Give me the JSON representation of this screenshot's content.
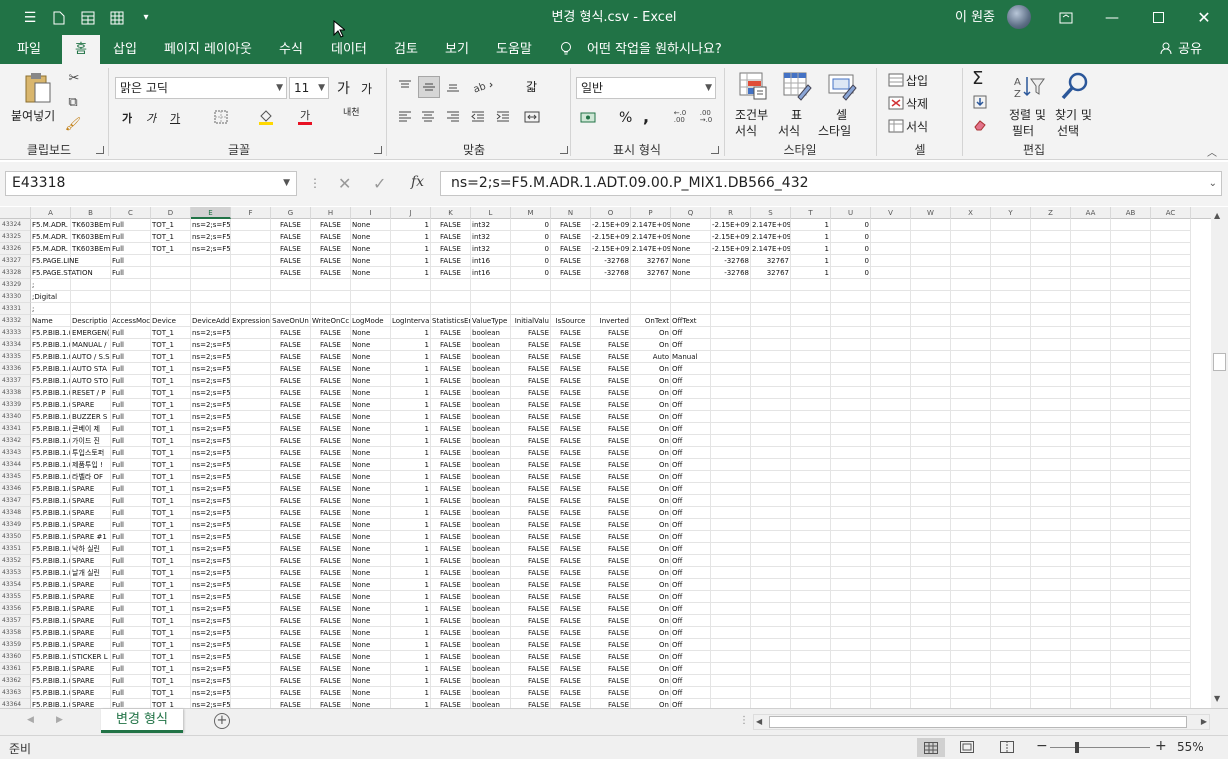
{
  "titlebar": {
    "title": "변경 형식.csv  -  Excel",
    "user": "이 원종",
    "qa_icons": [
      "menu-icon",
      "new-file-icon",
      "table-icon",
      "grid-icon",
      "customize-icon"
    ]
  },
  "tabs": [
    "파일",
    "홈",
    "삽입",
    "페이지 레이아웃",
    "수식",
    "데이터",
    "검토",
    "보기",
    "도움말"
  ],
  "tell_me": "어떤 작업을 원하시나요?",
  "share": "공유",
  "ribbon": {
    "clipboard": {
      "label": "클립보드",
      "paste": "붙여넣기"
    },
    "font": {
      "label": "글꼴",
      "name": "맑은 고딕",
      "size": "11",
      "bold": "가",
      "italic": "가",
      "underline": "가",
      "grow": "가",
      "shrink": "가",
      "phonetic": "내천"
    },
    "alignment": {
      "label": "맞춤",
      "wrap": "갋"
    },
    "number": {
      "label": "표시 형식",
      "format": "일반"
    },
    "styles": {
      "label": "스타일",
      "conditional": [
        "조건부",
        "서식"
      ],
      "table": [
        "표",
        "서식"
      ],
      "cell": [
        "셀",
        "스타일"
      ]
    },
    "cells": {
      "label": "셀",
      "insert": "삽입",
      "delete": "삭제",
      "format": "서식"
    },
    "editing": {
      "label": "편집",
      "sort": [
        "정렬 및",
        "필터"
      ],
      "find": [
        "찾기 및",
        "선택"
      ]
    }
  },
  "namebox": "E43318",
  "formula": "ns=2;s=F5.M.ADR.1.ADT.09.00.P_MIX1.DB566_432",
  "columns": [
    "A",
    "B",
    "C",
    "D",
    "E",
    "F",
    "G",
    "H",
    "I",
    "J",
    "K",
    "L",
    "M",
    "N",
    "O",
    "P",
    "Q",
    "R",
    "S",
    "T",
    "U",
    "V",
    "W",
    "X",
    "Y",
    "Z",
    "AA",
    "AB",
    "AC"
  ],
  "selected_column": "E",
  "rows": [
    {
      "n": "43324",
      "cells": [
        "F5.M.ADR.",
        "TK603BEm",
        "Full",
        "TOT_1",
        "ns=2;s=F5.M.ADR.1.A",
        "",
        "FALSE",
        "FALSE",
        "None",
        "1",
        "FALSE",
        "int32",
        "0",
        "FALSE",
        "-2.15E+09",
        "2.147E+09",
        "None",
        "-2.15E+09",
        "2.147E+09",
        "1",
        "0"
      ]
    },
    {
      "n": "43325",
      "cells": [
        "F5.M.ADR.",
        "TK603BEm",
        "Full",
        "TOT_1",
        "ns=2;s=F5.M.ADR.1.A",
        "",
        "FALSE",
        "FALSE",
        "None",
        "1",
        "FALSE",
        "int32",
        "0",
        "FALSE",
        "-2.15E+09",
        "2.147E+09",
        "None",
        "-2.15E+09",
        "2.147E+09",
        "1",
        "0"
      ]
    },
    {
      "n": "43326",
      "cells": [
        "F5.M.ADR.",
        "TK603BEm",
        "Full",
        "TOT_1",
        "ns=2;s=F5.M.ADR.1.A",
        "",
        "FALSE",
        "FALSE",
        "None",
        "1",
        "FALSE",
        "int32",
        "0",
        "FALSE",
        "-2.15E+09",
        "2.147E+09",
        "None",
        "-2.15E+09",
        "2.147E+09",
        "1",
        "0"
      ]
    },
    {
      "n": "43327",
      "cells": [
        "F5.PAGE.LINE",
        "",
        "Full",
        "",
        "",
        "",
        "FALSE",
        "FALSE",
        "None",
        "1",
        "FALSE",
        "int16",
        "0",
        "FALSE",
        "-32768",
        "32767",
        "None",
        "-32768",
        "32767",
        "1",
        "0"
      ]
    },
    {
      "n": "43328",
      "cells": [
        "F5.PAGE.STATION",
        "",
        "Full",
        "",
        "",
        "",
        "FALSE",
        "FALSE",
        "None",
        "1",
        "FALSE",
        "int16",
        "0",
        "FALSE",
        "-32768",
        "32767",
        "None",
        "-32768",
        "32767",
        "1",
        "0"
      ]
    },
    {
      "n": "43329",
      "cells": [
        ";"
      ]
    },
    {
      "n": "43330",
      "cells": [
        ";Digital"
      ]
    },
    {
      "n": "43331",
      "cells": [
        ";"
      ]
    },
    {
      "n": "43332",
      "cells": [
        "Name",
        "Descriptio",
        "AccessMoc",
        "Device",
        "DeviceAdd",
        "Expression",
        "SaveOnUn",
        "WriteOnCc",
        "LogMode",
        "LogInterva",
        "StatisticsEr",
        "ValueType",
        "InitialValu",
        "IsSource",
        "Inverted",
        "OnText",
        "OffText"
      ]
    },
    {
      "n": "43333",
      "cells": [
        "F5.P.BIB.1.(",
        "EMERGEN(",
        "Full",
        "TOT_1",
        "ns=2;s=F5.P.BIB.1.CS(",
        "",
        "FALSE",
        "FALSE",
        "None",
        "1",
        "FALSE",
        "boolean",
        "FALSE",
        "FALSE",
        "FALSE",
        "On",
        "Off"
      ]
    },
    {
      "n": "43334",
      "cells": [
        "F5.P.BIB.1.(",
        "MANUAL /",
        "Full",
        "TOT_1",
        "ns=2;s=F5.P.BIB.1.CS(",
        "",
        "FALSE",
        "FALSE",
        "None",
        "1",
        "FALSE",
        "boolean",
        "FALSE",
        "FALSE",
        "FALSE",
        "On",
        "Off"
      ]
    },
    {
      "n": "43335",
      "cells": [
        "F5.P.BIB.1.(",
        "AUTO / S.S",
        "Full",
        "TOT_1",
        "ns=2;s=F5.P.BIB.1.CS(",
        "",
        "FALSE",
        "FALSE",
        "None",
        "1",
        "FALSE",
        "boolean",
        "FALSE",
        "FALSE",
        "FALSE",
        "Auto",
        "Manual"
      ]
    },
    {
      "n": "43336",
      "cells": [
        "F5.P.BIB.1.(",
        "AUTO STA",
        "Full",
        "TOT_1",
        "ns=2;s=F5.P.BIB.1.CS(",
        "",
        "FALSE",
        "FALSE",
        "None",
        "1",
        "FALSE",
        "boolean",
        "FALSE",
        "FALSE",
        "FALSE",
        "On",
        "Off"
      ]
    },
    {
      "n": "43337",
      "cells": [
        "F5.P.BIB.1.(",
        "AUTO STO",
        "Full",
        "TOT_1",
        "ns=2;s=F5.P.BIB.1.CS(",
        "",
        "FALSE",
        "FALSE",
        "None",
        "1",
        "FALSE",
        "boolean",
        "FALSE",
        "FALSE",
        "FALSE",
        "On",
        "Off"
      ]
    },
    {
      "n": "43338",
      "cells": [
        "F5.P.BIB.1.(",
        "RESET / P",
        "Full",
        "TOT_1",
        "ns=2;s=F5.P.BIB.1.CS(",
        "",
        "FALSE",
        "FALSE",
        "None",
        "1",
        "FALSE",
        "boolean",
        "FALSE",
        "FALSE",
        "FALSE",
        "On",
        "Off"
      ]
    },
    {
      "n": "43339",
      "cells": [
        "F5.P.BIB.1.(",
        "SPARE",
        "Full",
        "TOT_1",
        "ns=2;s=F5.P.BIB.1.CS(",
        "",
        "FALSE",
        "FALSE",
        "None",
        "1",
        "FALSE",
        "boolean",
        "FALSE",
        "FALSE",
        "FALSE",
        "On",
        "Off"
      ]
    },
    {
      "n": "43340",
      "cells": [
        "F5.P.BIB.1.(",
        "BUZZER S",
        "Full",
        "TOT_1",
        "ns=2;s=F5.P.BIB.1.CS(",
        "",
        "FALSE",
        "FALSE",
        "None",
        "1",
        "FALSE",
        "boolean",
        "FALSE",
        "FALSE",
        "FALSE",
        "On",
        "Off"
      ]
    },
    {
      "n": "43341",
      "cells": [
        "F5.P.BIB.1.(",
        "콘베이 제",
        "Full",
        "TOT_1",
        "ns=2;s=F5.P.BIB.1.CS(",
        "",
        "FALSE",
        "FALSE",
        "None",
        "1",
        "FALSE",
        "boolean",
        "FALSE",
        "FALSE",
        "FALSE",
        "On",
        "Off"
      ]
    },
    {
      "n": "43342",
      "cells": [
        "F5.P.BIB.1.(",
        "가이드 진",
        "Full",
        "TOT_1",
        "ns=2;s=F5.P.BIB.1.CS(",
        "",
        "FALSE",
        "FALSE",
        "None",
        "1",
        "FALSE",
        "boolean",
        "FALSE",
        "FALSE",
        "FALSE",
        "On",
        "Off"
      ]
    },
    {
      "n": "43343",
      "cells": [
        "F5.P.BIB.1.(",
        "투입스토퍼",
        "Full",
        "TOT_1",
        "ns=2;s=F5.P.BIB.1.CS(",
        "",
        "FALSE",
        "FALSE",
        "None",
        "1",
        "FALSE",
        "boolean",
        "FALSE",
        "FALSE",
        "FALSE",
        "On",
        "Off"
      ]
    },
    {
      "n": "43344",
      "cells": [
        "F5.P.BIB.1.(",
        "제품투입 !",
        "Full",
        "TOT_1",
        "ns=2;s=F5.P.BIB.1.CS(",
        "",
        "FALSE",
        "FALSE",
        "None",
        "1",
        "FALSE",
        "boolean",
        "FALSE",
        "FALSE",
        "FALSE",
        "On",
        "Off"
      ]
    },
    {
      "n": "43345",
      "cells": [
        "F5.P.BIB.1.(",
        "라벨라 OF",
        "Full",
        "TOT_1",
        "ns=2;s=F5.P.BIB.1.CS(",
        "",
        "FALSE",
        "FALSE",
        "None",
        "1",
        "FALSE",
        "boolean",
        "FALSE",
        "FALSE",
        "FALSE",
        "On",
        "Off"
      ]
    },
    {
      "n": "43346",
      "cells": [
        "F5.P.BIB.1.(",
        "SPARE",
        "Full",
        "TOT_1",
        "ns=2;s=F5.P.BIB.1.CS(",
        "",
        "FALSE",
        "FALSE",
        "None",
        "1",
        "FALSE",
        "boolean",
        "FALSE",
        "FALSE",
        "FALSE",
        "On",
        "Off"
      ]
    },
    {
      "n": "43347",
      "cells": [
        "F5.P.BIB.1.(",
        "SPARE",
        "Full",
        "TOT_1",
        "ns=2;s=F5.P.BIB.1.CS(",
        "",
        "FALSE",
        "FALSE",
        "None",
        "1",
        "FALSE",
        "boolean",
        "FALSE",
        "FALSE",
        "FALSE",
        "On",
        "Off"
      ]
    },
    {
      "n": "43348",
      "cells": [
        "F5.P.BIB.1.(",
        "SPARE",
        "Full",
        "TOT_1",
        "ns=2;s=F5.P.BIB.1.CS(",
        "",
        "FALSE",
        "FALSE",
        "None",
        "1",
        "FALSE",
        "boolean",
        "FALSE",
        "FALSE",
        "FALSE",
        "On",
        "Off"
      ]
    },
    {
      "n": "43349",
      "cells": [
        "F5.P.BIB.1.(",
        "SPARE",
        "Full",
        "TOT_1",
        "ns=2;s=F5.P.BIB.1.CS(",
        "",
        "FALSE",
        "FALSE",
        "None",
        "1",
        "FALSE",
        "boolean",
        "FALSE",
        "FALSE",
        "FALSE",
        "On",
        "Off"
      ]
    },
    {
      "n": "43350",
      "cells": [
        "F5.P.BIB.1.(",
        "SPARE #1",
        "Full",
        "TOT_1",
        "ns=2;s=F5.P.BIB.1.CS(",
        "",
        "FALSE",
        "FALSE",
        "None",
        "1",
        "FALSE",
        "boolean",
        "FALSE",
        "FALSE",
        "FALSE",
        "On",
        "Off"
      ]
    },
    {
      "n": "43351",
      "cells": [
        "F5.P.BIB.1.(",
        "낙하 실린",
        "Full",
        "TOT_1",
        "ns=2;s=F5.P.BIB.1.CS(",
        "",
        "FALSE",
        "FALSE",
        "None",
        "1",
        "FALSE",
        "boolean",
        "FALSE",
        "FALSE",
        "FALSE",
        "On",
        "Off"
      ]
    },
    {
      "n": "43352",
      "cells": [
        "F5.P.BIB.1.(",
        "SPARE",
        "Full",
        "TOT_1",
        "ns=2;s=F5.P.BIB.1.CS(",
        "",
        "FALSE",
        "FALSE",
        "None",
        "1",
        "FALSE",
        "boolean",
        "FALSE",
        "FALSE",
        "FALSE",
        "On",
        "Off"
      ]
    },
    {
      "n": "43353",
      "cells": [
        "F5.P.BIB.1.(",
        "날개 실린",
        "Full",
        "TOT_1",
        "ns=2;s=F5.P.BIB.1.CS(",
        "",
        "FALSE",
        "FALSE",
        "None",
        "1",
        "FALSE",
        "boolean",
        "FALSE",
        "FALSE",
        "FALSE",
        "On",
        "Off"
      ]
    },
    {
      "n": "43354",
      "cells": [
        "F5.P.BIB.1.(",
        "SPARE",
        "Full",
        "TOT_1",
        "ns=2;s=F5.P.BIB.1.CS(",
        "",
        "FALSE",
        "FALSE",
        "None",
        "1",
        "FALSE",
        "boolean",
        "FALSE",
        "FALSE",
        "FALSE",
        "On",
        "Off"
      ]
    },
    {
      "n": "43355",
      "cells": [
        "F5.P.BIB.1.(",
        "SPARE",
        "Full",
        "TOT_1",
        "ns=2;s=F5.P.BIB.1.CS(",
        "",
        "FALSE",
        "FALSE",
        "None",
        "1",
        "FALSE",
        "boolean",
        "FALSE",
        "FALSE",
        "FALSE",
        "On",
        "Off"
      ]
    },
    {
      "n": "43356",
      "cells": [
        "F5.P.BIB.1.(",
        "SPARE",
        "Full",
        "TOT_1",
        "ns=2;s=F5.P.BIB.1.CS(",
        "",
        "FALSE",
        "FALSE",
        "None",
        "1",
        "FALSE",
        "boolean",
        "FALSE",
        "FALSE",
        "FALSE",
        "On",
        "Off"
      ]
    },
    {
      "n": "43357",
      "cells": [
        "F5.P.BIB.1.(",
        "SPARE",
        "Full",
        "TOT_1",
        "ns=2;s=F5.P.BIB.1.CS(",
        "",
        "FALSE",
        "FALSE",
        "None",
        "1",
        "FALSE",
        "boolean",
        "FALSE",
        "FALSE",
        "FALSE",
        "On",
        "Off"
      ]
    },
    {
      "n": "43358",
      "cells": [
        "F5.P.BIB.1.(",
        "SPARE",
        "Full",
        "TOT_1",
        "ns=2;s=F5.P.BIB.1.CS(",
        "",
        "FALSE",
        "FALSE",
        "None",
        "1",
        "FALSE",
        "boolean",
        "FALSE",
        "FALSE",
        "FALSE",
        "On",
        "Off"
      ]
    },
    {
      "n": "43359",
      "cells": [
        "F5.P.BIB.1.(",
        "SPARE",
        "Full",
        "TOT_1",
        "ns=2;s=F5.P.BIB.1.CS(",
        "",
        "FALSE",
        "FALSE",
        "None",
        "1",
        "FALSE",
        "boolean",
        "FALSE",
        "FALSE",
        "FALSE",
        "On",
        "Off"
      ]
    },
    {
      "n": "43360",
      "cells": [
        "F5.P.BIB.1.(",
        "STICKER L",
        "Full",
        "TOT_1",
        "ns=2;s=F5.P.BIB.1.CS(",
        "",
        "FALSE",
        "FALSE",
        "None",
        "1",
        "FALSE",
        "boolean",
        "FALSE",
        "FALSE",
        "FALSE",
        "On",
        "Off"
      ]
    },
    {
      "n": "43361",
      "cells": [
        "F5.P.BIB.1.(",
        "SPARE",
        "Full",
        "TOT_1",
        "ns=2;s=F5.P.BIB.1.CS(",
        "",
        "FALSE",
        "FALSE",
        "None",
        "1",
        "FALSE",
        "boolean",
        "FALSE",
        "FALSE",
        "FALSE",
        "On",
        "Off"
      ]
    },
    {
      "n": "43362",
      "cells": [
        "F5.P.BIB.1.(",
        "SPARE",
        "Full",
        "TOT_1",
        "ns=2;s=F5.P.BIB.1.CS(",
        "",
        "FALSE",
        "FALSE",
        "None",
        "1",
        "FALSE",
        "boolean",
        "FALSE",
        "FALSE",
        "FALSE",
        "On",
        "Off"
      ]
    },
    {
      "n": "43363",
      "cells": [
        "F5.P.BIB.1.(",
        "SPARE",
        "Full",
        "TOT_1",
        "ns=2;s=F5.P.BIB.1.CS(",
        "",
        "FALSE",
        "FALSE",
        "None",
        "1",
        "FALSE",
        "boolean",
        "FALSE",
        "FALSE",
        "FALSE",
        "On",
        "Off"
      ]
    },
    {
      "n": "43364",
      "cells": [
        "F5.P.BIB.1.(",
        "SPARE",
        "Full",
        "TOT_1",
        "ns=2;s=F5.P.BIB.1.CS(",
        "",
        "FALSE",
        "FALSE",
        "None",
        "1",
        "FALSE",
        "boolean",
        "FALSE",
        "FALSE",
        "FALSE",
        "On",
        "Off"
      ]
    }
  ],
  "sheet_tab": "변경 형식",
  "status": {
    "ready": "준비",
    "zoom": "55%",
    "zoom_minus": "−",
    "zoom_plus": "+"
  },
  "colors": {
    "brand": "#217346",
    "ribbon_bg": "#f3f3f3"
  }
}
